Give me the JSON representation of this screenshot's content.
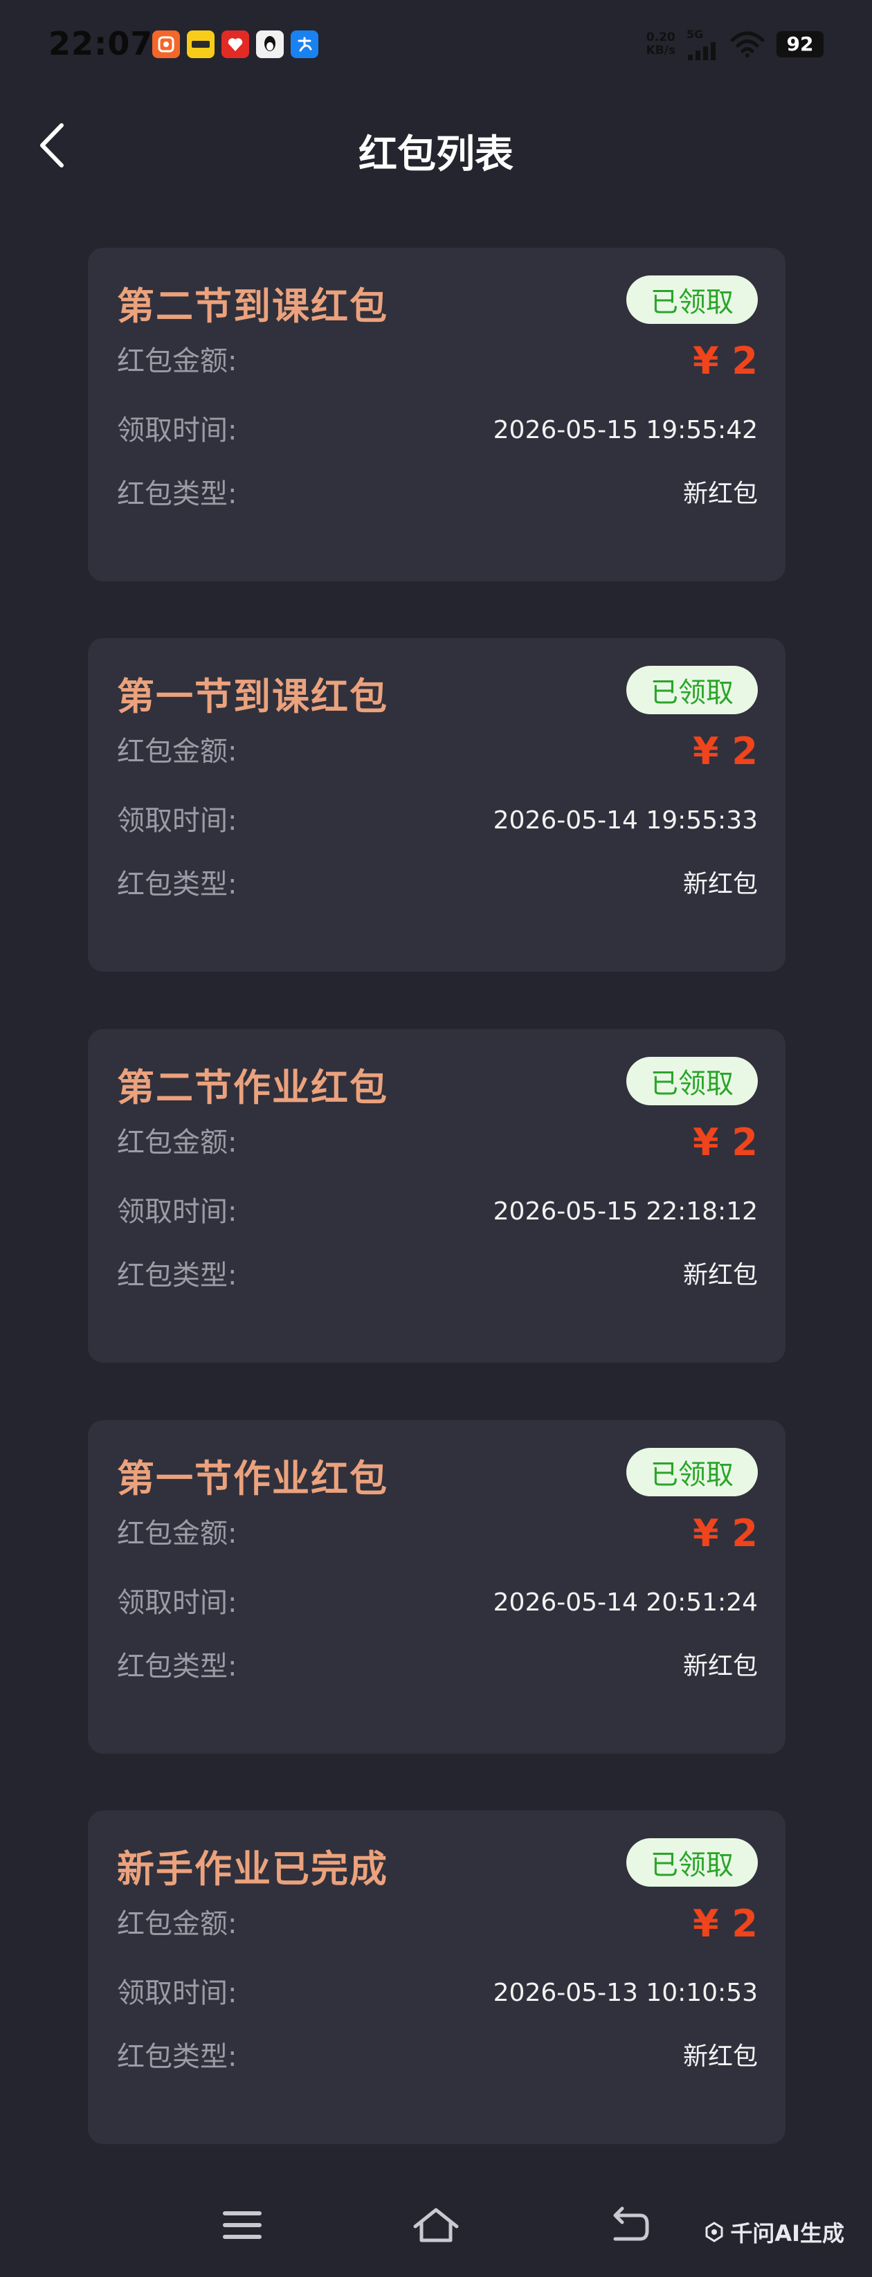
{
  "status_bar": {
    "time": "22:07",
    "net_speed_value": "0.20",
    "net_speed_unit": "KB/s",
    "signal_type": "5G",
    "battery": "92",
    "notification_icons": [
      {
        "name": "taobao-app-icon",
        "color": "#f3672a"
      },
      {
        "name": "meituan-app-icon",
        "color": "#f8cd1a"
      },
      {
        "name": "pinduoduo-app-icon",
        "color": "#e22b25"
      },
      {
        "name": "qq-app-icon",
        "color": "#f1f1f1"
      },
      {
        "name": "alipay-app-icon",
        "color": "#1a82f0"
      }
    ]
  },
  "header": {
    "title": "红包列表",
    "back_icon": "chevron-left-icon"
  },
  "labels": {
    "amount": "红包金额:",
    "time": "领取时间:",
    "type": "红包类型:"
  },
  "cards": [
    {
      "title": "第二节到课红包",
      "status": "已领取",
      "amount": "¥ 2",
      "time": "2026-05-15 19:55:42",
      "type": "新红包"
    },
    {
      "title": "第一节到课红包",
      "status": "已领取",
      "amount": "¥ 2",
      "time": "2026-05-14 19:55:33",
      "type": "新红包"
    },
    {
      "title": "第二节作业红包",
      "status": "已领取",
      "amount": "¥ 2",
      "time": "2026-05-15 22:18:12",
      "type": "新红包"
    },
    {
      "title": "第一节作业红包",
      "status": "已领取",
      "amount": "¥ 2",
      "time": "2026-05-14 20:51:24",
      "type": "新红包"
    },
    {
      "title": "新手作业已完成",
      "status": "已领取",
      "amount": "¥ 2",
      "time": "2026-05-13 10:10:53",
      "type": "新红包"
    }
  ],
  "nav_bar": {
    "menu_icon": "menu-icon",
    "home_icon": "home-icon",
    "back_icon": "back-arrow-icon"
  },
  "watermark": "千问AI生成",
  "colors": {
    "background": "#24252e",
    "card": "#30313c",
    "card_title": "#eba27d",
    "amount": "#f0441d",
    "badge_bg": "#e9f8e5",
    "badge_text": "#2aa52a"
  }
}
